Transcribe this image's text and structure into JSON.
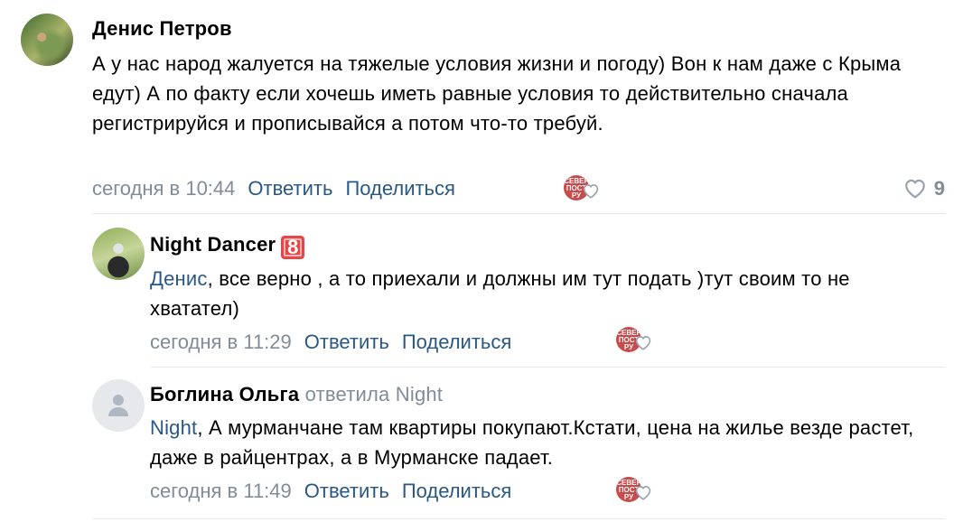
{
  "comments": [
    {
      "author": "Денис Петров",
      "text": "А у нас народ жалуется на тяжелые условия жизни и погоду) Вон к нам даже с Крыма едут) А по факту если хочешь иметь равные условия то действительно сначала регистрируйся и прописывайся а потом что-то требуй.",
      "time": "сегодня в 10:44",
      "reply": "Ответить",
      "share": "Поделиться",
      "reaction_label": "СЕВЕР ПОСТ РУ",
      "likes": "9"
    },
    {
      "author": "Night Dancer",
      "badge": "8",
      "mention": "Денис",
      "text": ", все верно , а то приехали и должны им тут подать )тут своим то не хватател)",
      "time": "сегодня в 11:29",
      "reply": "Ответить",
      "share": "Поделиться",
      "reaction_label": "СЕВЕР ПОСТ РУ"
    },
    {
      "author": "Боглина Ольга",
      "replied_to": "ответила Night",
      "mention": "Night",
      "text": ", А мурманчане там квартиры покупают.Кстати, цена на жилье везде растет, даже в райцентрах, а в Мурманске падает.",
      "time": "сегодня в 11:49",
      "reply": "Ответить",
      "share": "Поделиться",
      "reaction_label": "СЕВЕР ПОСТ РУ"
    }
  ],
  "colors": {
    "link": "#2a5885",
    "meta": "#818c99",
    "divider": "#e7e8ec",
    "badge": "#e64646"
  }
}
